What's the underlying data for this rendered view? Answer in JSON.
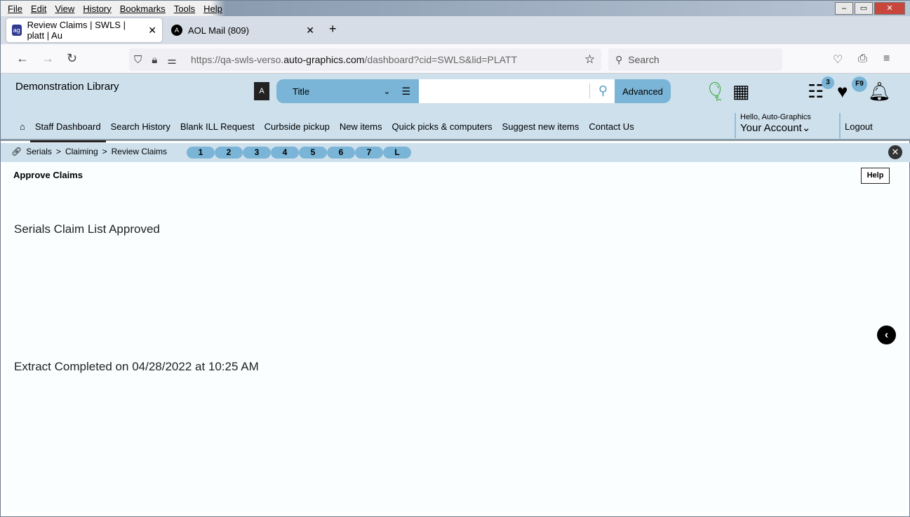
{
  "menu": [
    "File",
    "Edit",
    "View",
    "History",
    "Bookmarks",
    "Tools",
    "Help"
  ],
  "tabs": [
    {
      "title": "Review Claims | SWLS | platt | Au"
    },
    {
      "title": "AOL Mail (809)"
    }
  ],
  "url": {
    "prefix": "https://qa-swls-verso.",
    "domain": "auto-graphics.com",
    "path": "/dashboard?cid=SWLS&lid=PLATT"
  },
  "browser_search": "Search",
  "library": "Demonstration Library",
  "search": {
    "type": "Title",
    "value": "",
    "advanced": "Advanced"
  },
  "badges": {
    "list": "3",
    "fav": "F9"
  },
  "nav": [
    "Staff Dashboard",
    "Search History",
    "Blank ILL Request",
    "Curbside pickup",
    "New items",
    "Quick picks & computers",
    "Suggest new items",
    "Contact Us"
  ],
  "account": {
    "hello": "Hello, Auto-Graphics",
    "label": "Your Account",
    "logout": "Logout"
  },
  "breadcrumb": [
    "Serials",
    ">",
    "Claiming",
    ">",
    "Review Claims"
  ],
  "pages": [
    "1",
    "2",
    "3",
    "4",
    "5",
    "6",
    "7",
    "L"
  ],
  "main": {
    "title": "Approve Claims",
    "help": "Help",
    "message1": "Serials Claim List Approved",
    "message2": "Extract Completed on 04/28/2022 at 10:25 AM"
  }
}
